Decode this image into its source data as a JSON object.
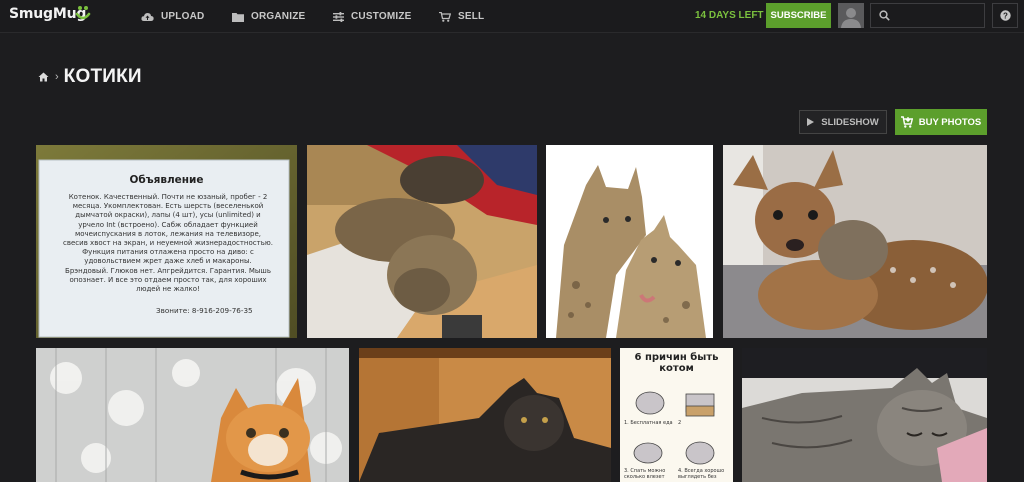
{
  "brand": {
    "name": "SmugMug"
  },
  "nav": {
    "upload": "UPLOAD",
    "organize": "ORGANIZE",
    "customize": "CUSTOMIZE",
    "sell": "SELL"
  },
  "trial": {
    "days_left": "14 DAYS LEFT",
    "subscribe": "SUBSCRIBE"
  },
  "search": {
    "value": ""
  },
  "help": {
    "label": "?"
  },
  "breadcrumb": {
    "title": "КОТИКИ"
  },
  "actions": {
    "slideshow": "SLIDESHOW",
    "buy_photos": "BUY PHOTOS"
  },
  "notice": {
    "heading": "Объявление",
    "lines": [
      "Котенок. Качественный. Почти не юзаный, пробег - 2",
      "месяца. Укомплектован. Есть шерсть (веселенькой",
      "дымчатой окраски), лапы (4 шт), усы (unlimited) и",
      "урчело Int (встроено). Сабж обладает функцией",
      "мочеиспускания в лоток, лежания на телевизоре,",
      "свесив хвост на экран, и неуемной жизнерадостностью.",
      "Функция питания отлажена просто на диво: с",
      "удовольствием жрет даже хлеб и макароны.",
      "Брэндовый. Глюков нет. Апгрейдится. Гарантия. Мышь",
      "опознает. И все это отдаем просто так, для хороших",
      "людей не жалко!"
    ],
    "phone": "Звоните: 8-916-209-76-35"
  },
  "comic": {
    "title_line1": "6 причин быть",
    "title_line2": "котом",
    "n1": "1. Бесплатная еда",
    "n2": "2",
    "n3": "3. Спать можно сколько влезет",
    "n4": "4. Всегда хорошо выглядеть без"
  },
  "colors": {
    "accent_green": "#5c9f2c",
    "days_green": "#7bc13e",
    "background": "#1d1d1f"
  }
}
